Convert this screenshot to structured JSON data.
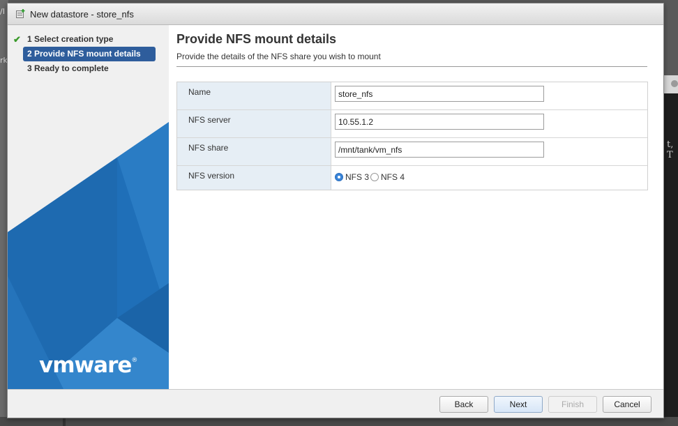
{
  "backdrop": {
    "left_fragment_1": "/I",
    "left_fragment_2": "rk",
    "right_fragment": "t, T"
  },
  "dialog": {
    "title": "New datastore - store_nfs",
    "title_icon": "datastore-add-icon"
  },
  "steps": [
    {
      "label": "1 Select creation type",
      "state": "completed"
    },
    {
      "label": "2 Provide NFS mount details",
      "state": "active"
    },
    {
      "label": "3 Ready to complete",
      "state": "pending"
    }
  ],
  "logo": {
    "text": "vmware",
    "registered": "®"
  },
  "main": {
    "title": "Provide NFS mount details",
    "subtitle": "Provide the details of the NFS share you wish to mount"
  },
  "form": {
    "name": {
      "label": "Name",
      "value": "store_nfs"
    },
    "nfs_server": {
      "label": "NFS server",
      "value": "10.55.1.2"
    },
    "nfs_share": {
      "label": "NFS share",
      "value": "/mnt/tank/vm_nfs"
    },
    "nfs_version": {
      "label": "NFS version",
      "options": [
        {
          "label": "NFS 3",
          "selected": true
        },
        {
          "label": "NFS 4",
          "selected": false
        }
      ]
    }
  },
  "footer": {
    "back": "Back",
    "next": "Next",
    "finish": "Finish",
    "cancel": "Cancel"
  },
  "colors": {
    "active_step": "#2e5d9c",
    "sidebar_blue": "#1f6fb8",
    "check": "#3a9a2a",
    "radio_selected": "#3a84d8"
  }
}
